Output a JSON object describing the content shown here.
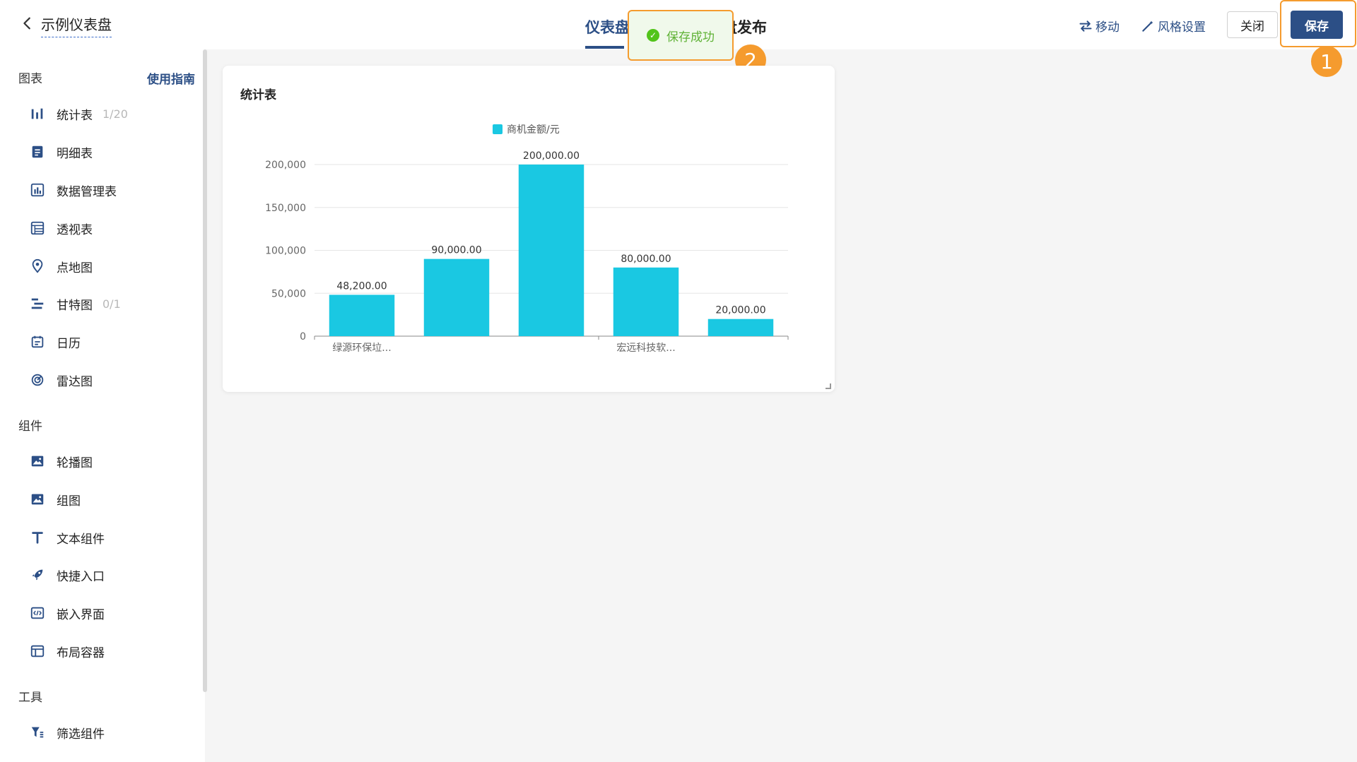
{
  "header": {
    "title": "示例仪表盘",
    "tabs": [
      {
        "label": "仪表盘"
      },
      {
        "label": "盘发布"
      }
    ],
    "move_label": "移动",
    "style_label": "风格设置",
    "close_label": "关闭",
    "save_label": "保存"
  },
  "toast": {
    "message": "保存成功"
  },
  "markers": {
    "m1": "1",
    "m2": "2"
  },
  "sidebar": {
    "charts_title": "图表",
    "guide_label": "使用指南",
    "chart_items": [
      {
        "label": "统计表",
        "count": "1/20",
        "icon": "bar-chart-icon"
      },
      {
        "label": "明细表",
        "icon": "document-icon"
      },
      {
        "label": "数据管理表",
        "icon": "data-table-icon"
      },
      {
        "label": "透视表",
        "icon": "pivot-table-icon"
      },
      {
        "label": "点地图",
        "icon": "map-pin-icon"
      },
      {
        "label": "甘特图",
        "count": "0/1",
        "icon": "gantt-icon"
      },
      {
        "label": "日历",
        "icon": "calendar-icon"
      },
      {
        "label": "雷达图",
        "icon": "radar-icon"
      }
    ],
    "components_title": "组件",
    "component_items": [
      {
        "label": "轮播图",
        "icon": "image-icon"
      },
      {
        "label": "组图",
        "icon": "image-group-icon"
      },
      {
        "label": "文本组件",
        "icon": "text-icon"
      },
      {
        "label": "快捷入口",
        "icon": "rocket-icon"
      },
      {
        "label": "嵌入界面",
        "icon": "embed-code-icon"
      },
      {
        "label": "布局容器",
        "icon": "layout-icon"
      }
    ],
    "tools_title": "工具",
    "tool_items": [
      {
        "label": "筛选组件",
        "icon": "filter-icon"
      }
    ]
  },
  "card": {
    "title": "统计表"
  },
  "colors": {
    "accent": "#2c4f86",
    "bar": "#1ac8e2",
    "highlight": "#f59b2e",
    "success": "#52c41a"
  },
  "chart_data": {
    "type": "bar",
    "title": "统计表",
    "categories": [
      "绿源环保垃...",
      "",
      "",
      "宏远科技软...",
      ""
    ],
    "series": [
      {
        "name": "商机金额/元",
        "values": [
          48200,
          90000,
          200000,
          80000,
          20000
        ]
      }
    ],
    "data_labels": [
      "48,200.00",
      "90,000.00",
      "200,000.00",
      "80,000.00",
      "20,000.00"
    ],
    "ylim": [
      0,
      200000
    ],
    "yticks": [
      0,
      50000,
      100000,
      150000,
      200000
    ],
    "ytick_labels": [
      "0",
      "50,000",
      "100,000",
      "150,000",
      "200,000"
    ],
    "grid": true,
    "legend": "top-center"
  }
}
